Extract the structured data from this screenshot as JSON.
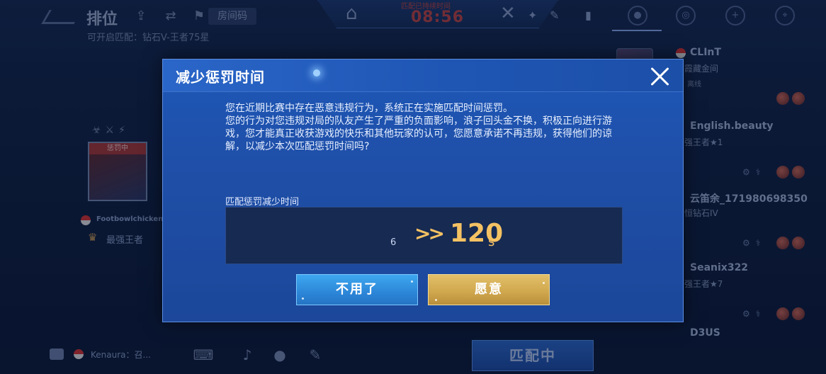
{
  "lobby": {
    "mode_title": "排位",
    "mode_subtitle": "可开启匹配：钻石V-王者75星",
    "room_code_label": "房间码",
    "timer_label": "匹配已持续时间",
    "timer_value": "08:56",
    "player": {
      "status": "惩罚中",
      "name": "Footbowlchicken",
      "rank": "最强王者"
    },
    "friends": [
      {
        "name": "CLInT",
        "rank": "霞藏金间",
        "status": "离线"
      },
      {
        "name": "English.beauty",
        "rank": "强王者★1",
        "status": ""
      },
      {
        "name": "云笛余_171980698350",
        "rank": "恒钻石IV",
        "status": ""
      },
      {
        "name": "Seanix322",
        "rank": "强王者★7",
        "status": ""
      },
      {
        "name": "D3US",
        "rank": "",
        "status": ""
      }
    ],
    "chat_preview": "Kenaura：召...",
    "match_button": "匹配中"
  },
  "dialog": {
    "title": "减少惩罚时间",
    "body_lines": [
      "您在近期比赛中存在恶意违规行为，系统正在实施匹配时间惩罚。",
      "您的行为对您违规对局的队友产生了严重的负面影响，浪子回头金不换，积极正向进行游戏，您才能真正收获游戏的快乐和其他玩家的认可，您愿意承诺不再违规，获得他们的谅解，以减少本次匹配惩罚时间吗?"
    ],
    "reduce_label": "匹配惩罚减少时间",
    "old_time": "6",
    "arrow": ">>",
    "new_time": "120",
    "time_unit": "s",
    "decline_button": "不用了",
    "accept_button": "愿意"
  },
  "colors": {
    "accent_gold": "#f4c163",
    "dialog_blue": "#1f4fa8",
    "decline_blue": "#2c86d8",
    "accept_gold": "#cfa64c",
    "timer_red": "#c84848"
  },
  "icons": {
    "close": "close-icon",
    "home": "home-icon",
    "back": "back-arrow-icon",
    "flag": "flag-icon",
    "match_cancel": "crossed-swords-icon",
    "friends_tab": "friends-icon",
    "settings": "gear-icon",
    "chat": "chat-icon",
    "mic": "microphone-icon",
    "speaker": "speaker-icon"
  }
}
